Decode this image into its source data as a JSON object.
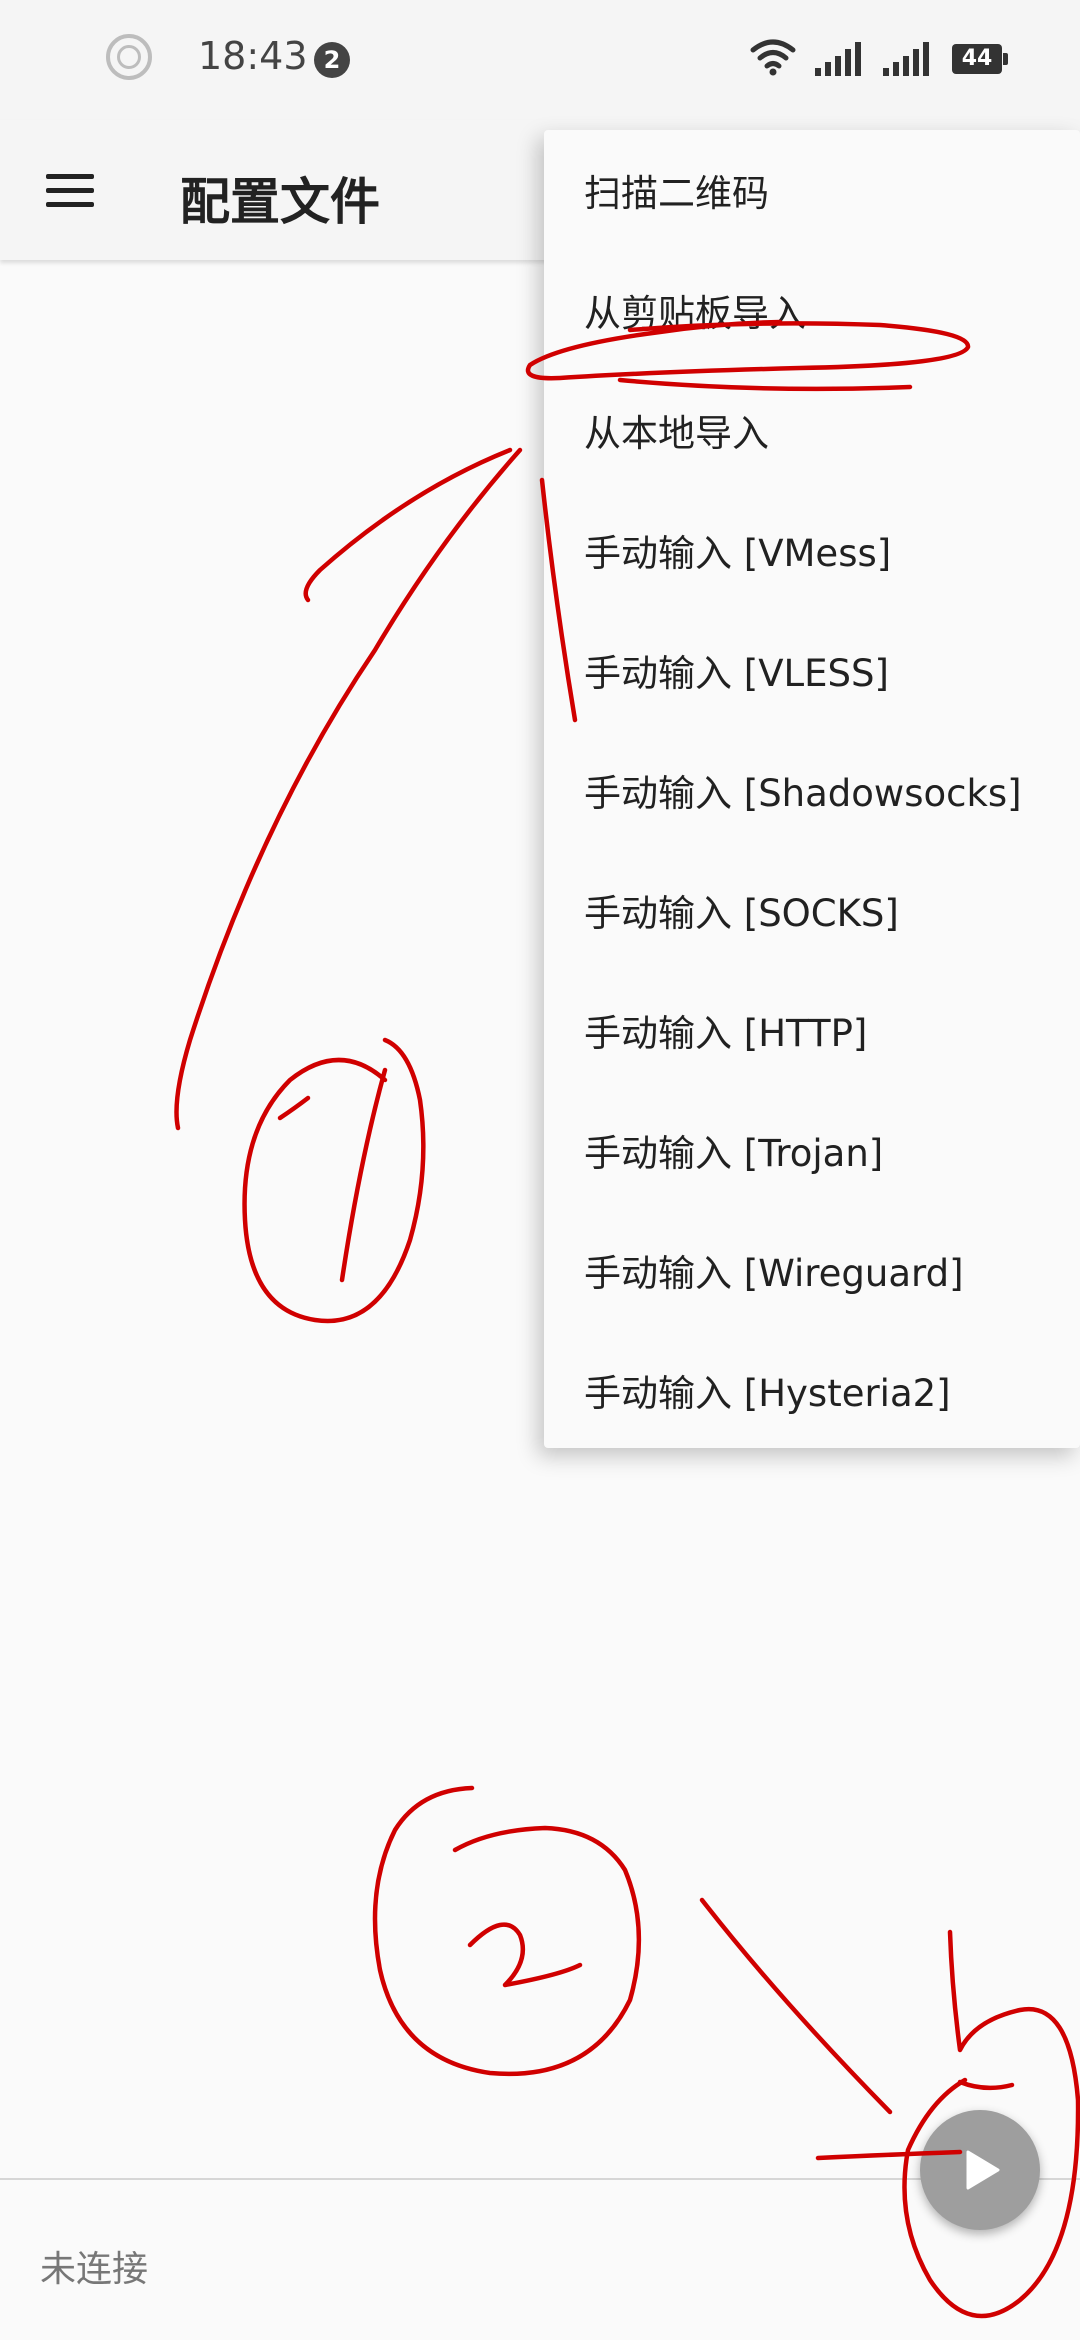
{
  "status_bar": {
    "time": "18:43",
    "notification_count": "2",
    "battery": "44",
    "icons": [
      "circle-status-icon",
      "wifi-icon",
      "cell-signal-icon",
      "cell-signal-icon"
    ]
  },
  "app_bar": {
    "title": "配置文件",
    "menu_icon": "hamburger-menu-icon"
  },
  "dropdown": {
    "items": [
      {
        "label": "扫描二维码"
      },
      {
        "label": "从剪贴板导入"
      },
      {
        "label": "从本地导入"
      },
      {
        "label": "手动输入 [VMess]"
      },
      {
        "label": "手动输入 [VLESS]"
      },
      {
        "label": "手动输入 [Shadowsocks]"
      },
      {
        "label": "手动输入 [SOCKS]"
      },
      {
        "label": "手动输入 [HTTP]"
      },
      {
        "label": "手动输入 [Trojan]"
      },
      {
        "label": "手动输入 [Wireguard]"
      },
      {
        "label": "手动输入 [Hysteria2]"
      }
    ]
  },
  "bottom": {
    "connection_status": "未连接",
    "fab_icon": "play-icon"
  },
  "colors": {
    "annotation": "#d00000",
    "fab": "#9e9e9e",
    "background": "#fafafa"
  }
}
